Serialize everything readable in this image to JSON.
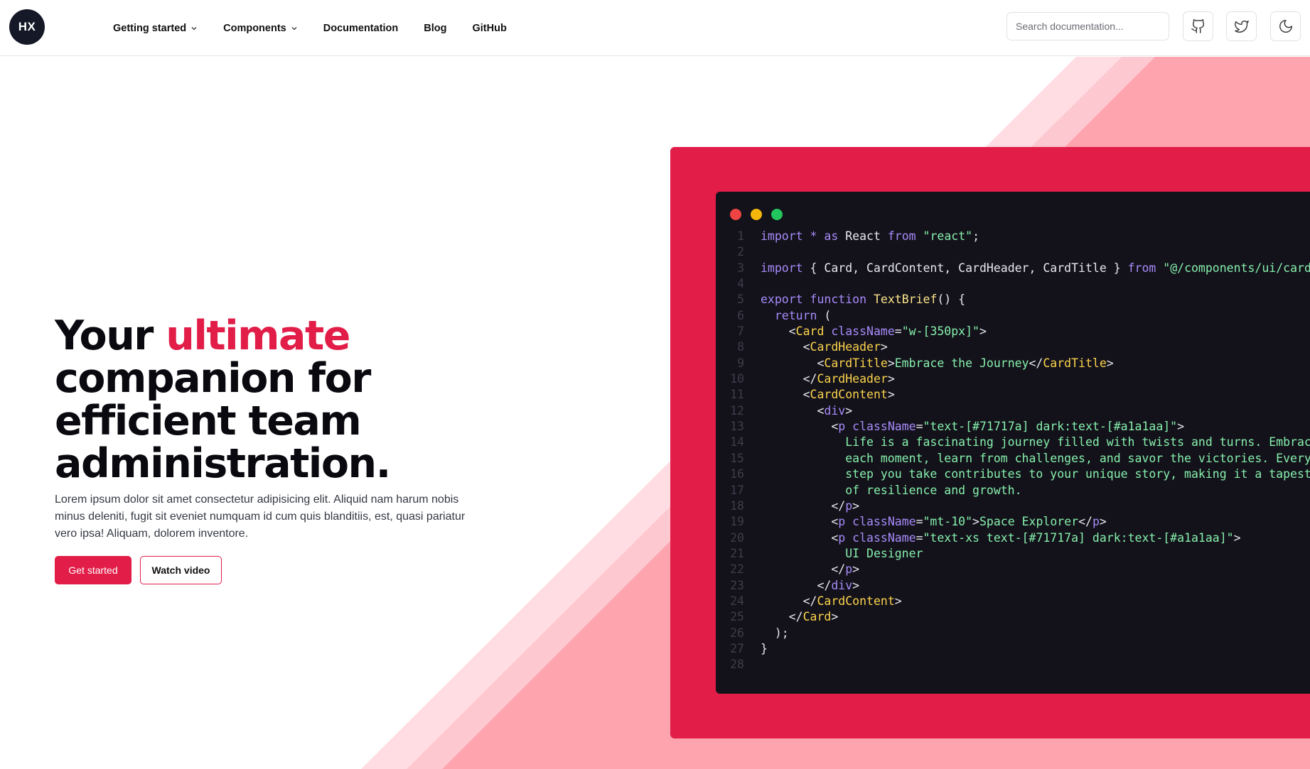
{
  "header": {
    "logo_text": "HX",
    "nav": [
      {
        "label": "Getting started",
        "has_dropdown": true
      },
      {
        "label": "Components",
        "has_dropdown": true
      },
      {
        "label": "Documentation",
        "has_dropdown": false
      },
      {
        "label": "Blog",
        "has_dropdown": false
      },
      {
        "label": "GitHub",
        "has_dropdown": false
      }
    ],
    "search_placeholder": "Search documentation...",
    "icons": [
      "github-icon",
      "twitter-icon",
      "moon-icon"
    ]
  },
  "hero": {
    "title_pre": "Your ",
    "title_accent": "ultimate",
    "title_post": " companion for efficient team administration.",
    "description": "Lorem ipsum dolor sit amet consectetur adipisicing elit. Aliquid nam harum nobis minus deleniti, fugit sit eveniet numquam id cum quis blanditiis, est, quasi pariatur vero ipsa! Aliquam, dolorem inventore.",
    "primary_button": "Get started",
    "secondary_button": "Watch video"
  },
  "colors": {
    "accent": "#e11d48",
    "logo_bg": "#141827",
    "code_bg": "#13121a",
    "stripe_light": "#ffdde2",
    "stripe_mid": "#fec8d0",
    "stripe_dark": "#fda4af",
    "dot_red": "#ef4444",
    "dot_yellow": "#f59e0b",
    "dot_green": "#22c55e"
  },
  "code": {
    "lines": [
      [
        [
          "kw",
          "import"
        ],
        [
          "p",
          " "
        ],
        [
          "kw",
          "*"
        ],
        [
          "p",
          " "
        ],
        [
          "kw",
          "as"
        ],
        [
          "p",
          " React "
        ],
        [
          "kw",
          "from"
        ],
        [
          "p",
          " "
        ],
        [
          "str",
          "\"react\""
        ],
        [
          "p",
          ";"
        ]
      ],
      [],
      [
        [
          "kw",
          "import"
        ],
        [
          "p",
          " { Card, CardContent, CardHeader, CardTitle } "
        ],
        [
          "kw",
          "from"
        ],
        [
          "p",
          " "
        ],
        [
          "str",
          "\"@/components/ui/card\""
        ]
      ],
      [],
      [
        [
          "kw",
          "export"
        ],
        [
          "p",
          " "
        ],
        [
          "kw",
          "function"
        ],
        [
          "p",
          " "
        ],
        [
          "fn",
          "TextBrief"
        ],
        [
          "p",
          "() {"
        ]
      ],
      [
        [
          "p",
          "  "
        ],
        [
          "kw",
          "return"
        ],
        [
          "p",
          " ("
        ]
      ],
      [
        [
          "p",
          "    <"
        ],
        [
          "tag",
          "Card"
        ],
        [
          "p",
          " "
        ],
        [
          "attr",
          "className"
        ],
        [
          "p",
          "="
        ],
        [
          "str",
          "\"w-[350px]\""
        ],
        [
          "p",
          ">"
        ]
      ],
      [
        [
          "p",
          "      <"
        ],
        [
          "tag",
          "CardHeader"
        ],
        [
          "p",
          ">"
        ]
      ],
      [
        [
          "p",
          "        <"
        ],
        [
          "tag",
          "CardTitle"
        ],
        [
          "p",
          ">"
        ],
        [
          "txt",
          "Embrace the Journey"
        ],
        [
          "p",
          "</"
        ],
        [
          "tag",
          "CardTitle"
        ],
        [
          "p",
          ">"
        ]
      ],
      [
        [
          "p",
          "      </"
        ],
        [
          "tag",
          "CardHeader"
        ],
        [
          "p",
          ">"
        ]
      ],
      [
        [
          "p",
          "      <"
        ],
        [
          "tag",
          "CardContent"
        ],
        [
          "p",
          ">"
        ]
      ],
      [
        [
          "p",
          "        <"
        ],
        [
          "attr",
          "div"
        ],
        [
          "p",
          ">"
        ]
      ],
      [
        [
          "p",
          "          <"
        ],
        [
          "attr",
          "p"
        ],
        [
          "p",
          " "
        ],
        [
          "attr",
          "className"
        ],
        [
          "p",
          "="
        ],
        [
          "str",
          "\"text-[#71717a] dark:text-[#a1a1aa]\""
        ],
        [
          "p",
          ">"
        ]
      ],
      [
        [
          "txt",
          "            Life is a fascinating journey filled with twists and turns. Embrace"
        ]
      ],
      [
        [
          "txt",
          "            each moment, learn from challenges, and savor the victories. Every"
        ]
      ],
      [
        [
          "txt",
          "            step you take contributes to your unique story, making it a tapestry"
        ]
      ],
      [
        [
          "txt",
          "            of resilience and growth."
        ]
      ],
      [
        [
          "p",
          "          </"
        ],
        [
          "attr",
          "p"
        ],
        [
          "p",
          ">"
        ]
      ],
      [
        [
          "p",
          "          <"
        ],
        [
          "attr",
          "p"
        ],
        [
          "p",
          " "
        ],
        [
          "attr",
          "className"
        ],
        [
          "p",
          "="
        ],
        [
          "str",
          "\"mt-10\""
        ],
        [
          "p",
          ">"
        ],
        [
          "txt",
          "Space Explorer"
        ],
        [
          "p",
          "</"
        ],
        [
          "attr",
          "p"
        ],
        [
          "p",
          ">"
        ]
      ],
      [
        [
          "p",
          "          <"
        ],
        [
          "attr",
          "p"
        ],
        [
          "p",
          " "
        ],
        [
          "attr",
          "className"
        ],
        [
          "p",
          "="
        ],
        [
          "str",
          "\"text-xs text-[#71717a] dark:text-[#a1a1aa]\""
        ],
        [
          "p",
          ">"
        ]
      ],
      [
        [
          "txt",
          "            UI Designer"
        ]
      ],
      [
        [
          "p",
          "          </"
        ],
        [
          "attr",
          "p"
        ],
        [
          "p",
          ">"
        ]
      ],
      [
        [
          "p",
          "        </"
        ],
        [
          "attr",
          "div"
        ],
        [
          "p",
          ">"
        ]
      ],
      [
        [
          "p",
          "      </"
        ],
        [
          "tag",
          "CardContent"
        ],
        [
          "p",
          ">"
        ]
      ],
      [
        [
          "p",
          "    </"
        ],
        [
          "tag",
          "Card"
        ],
        [
          "p",
          ">"
        ]
      ],
      [
        [
          "p",
          "  );"
        ]
      ],
      [
        [
          "p",
          "}"
        ]
      ],
      []
    ]
  }
}
